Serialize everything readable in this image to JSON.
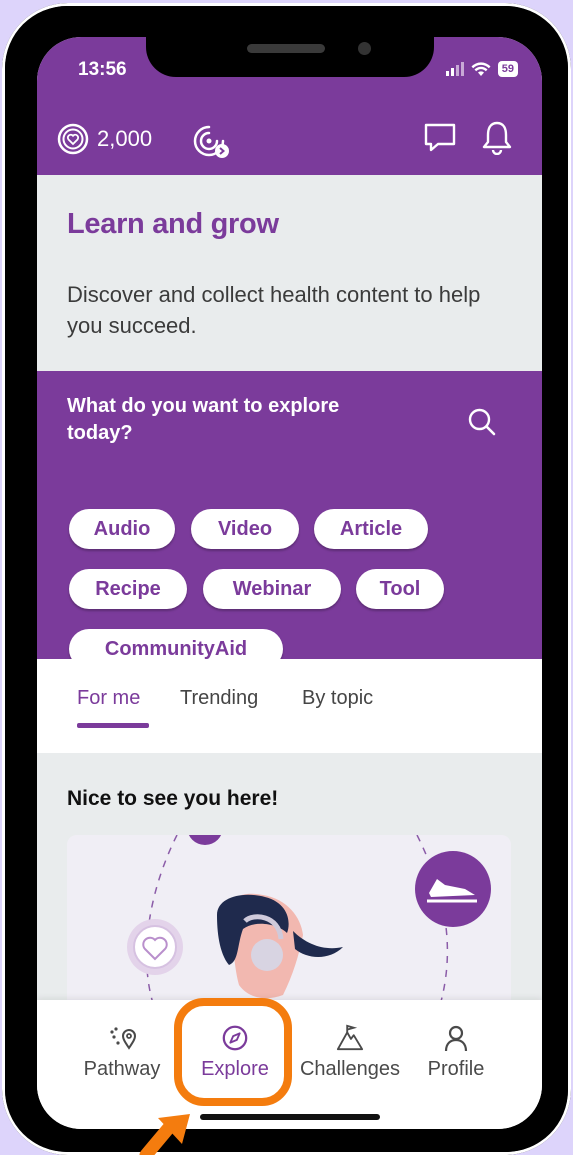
{
  "status_bar": {
    "time": "13:56",
    "battery": "59"
  },
  "header": {
    "coins": "2,000"
  },
  "hero": {
    "title": "Learn and grow",
    "description": "Discover and collect health content to help you succeed."
  },
  "explore": {
    "question": "What do you want to explore today?",
    "chips": [
      "Audio",
      "Video",
      "Article",
      "Recipe",
      "Webinar",
      "Tool",
      "CommunityAid"
    ]
  },
  "tabs": [
    "For me",
    "Trending",
    "By topic"
  ],
  "feed": {
    "title": "Nice to see you here!"
  },
  "nav": [
    "Pathway",
    "Explore",
    "Challenges",
    "Profile"
  ],
  "colors": {
    "brand": "#7b3b9b",
    "highlight": "#f47c0e",
    "background": "#ddd4fb"
  }
}
